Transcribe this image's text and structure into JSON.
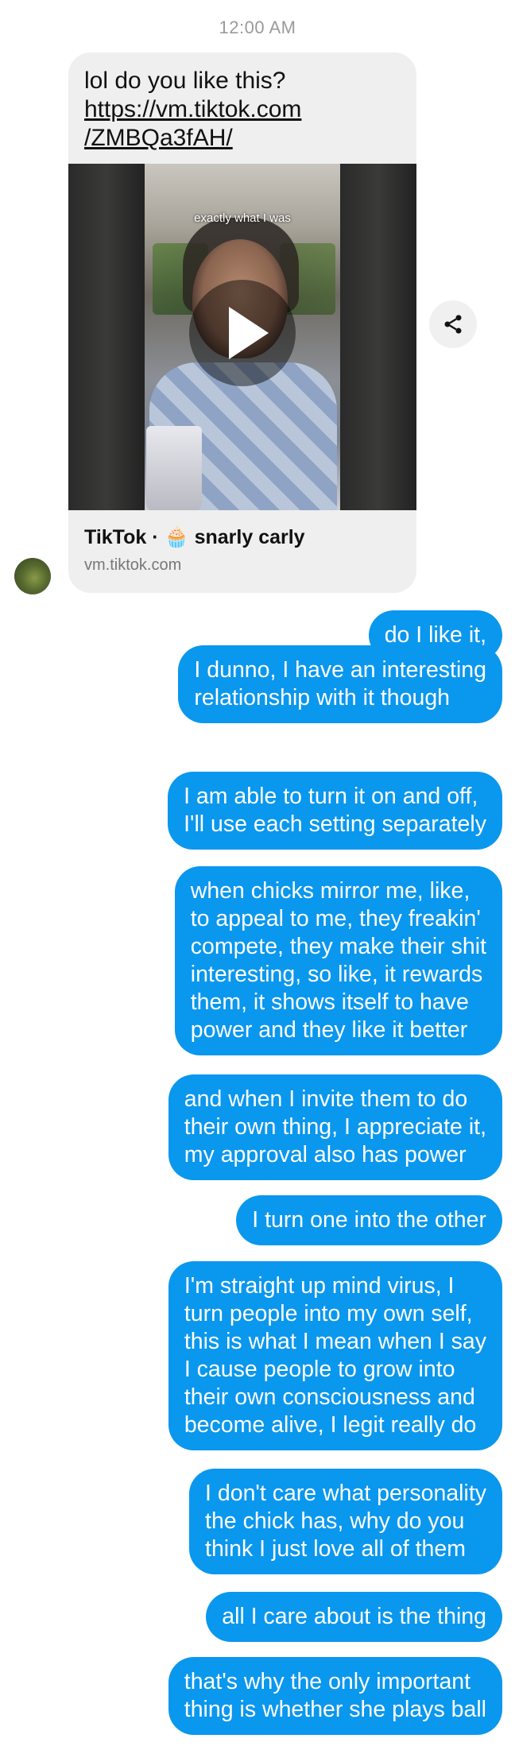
{
  "timestamp": "12:00 AM",
  "incoming": {
    "text": "lol do you like this?",
    "link_line1": "https://vm.tiktok.com",
    "link_line2": "/ZMBQa3fAH/",
    "video_caption": "exactly what I was",
    "preview_source": "TikTok",
    "preview_separator": "·",
    "preview_emoji": "🧁",
    "preview_author": "snarly carly",
    "preview_domain": "vm.tiktok.com"
  },
  "icons": {
    "share": "share-icon",
    "play": "play-icon",
    "avatar": "avatar"
  },
  "colors": {
    "outgoing_bubble": "#0a97ee",
    "incoming_bubble": "#efefef"
  },
  "messages": [
    {
      "lines": [
        "do I like it,"
      ]
    },
    {
      "lines": [
        "I dunno, I have an interesting",
        "relationship with it though"
      ]
    },
    {
      "lines": [
        "I am able to turn it on and off,",
        "I'll use each setting separately"
      ]
    },
    {
      "lines": [
        "when chicks mirror me, like,",
        "to appeal to me, they freakin'",
        "compete, they make their shit",
        "interesting, so like, it rewards",
        "them, it shows itself to have",
        "power and they like it better"
      ]
    },
    {
      "lines": [
        "and when I invite them to do",
        "their own thing, I appreciate it,",
        "my approval also has power"
      ]
    },
    {
      "lines": [
        "I turn one into the other"
      ]
    },
    {
      "lines": [
        "I'm straight up mind virus, I",
        "turn people into my own self,",
        "this is what I mean when I say",
        "I cause people to grow into",
        "their own consciousness and",
        "become alive, I legit really do"
      ]
    },
    {
      "lines": [
        "I don't care what personality",
        "the chick has, why do you",
        "think I just love all of them"
      ]
    },
    {
      "lines": [
        "all I care about is the thing"
      ]
    },
    {
      "lines": [
        "that's why the only important",
        "thing is whether she plays ball"
      ]
    }
  ]
}
